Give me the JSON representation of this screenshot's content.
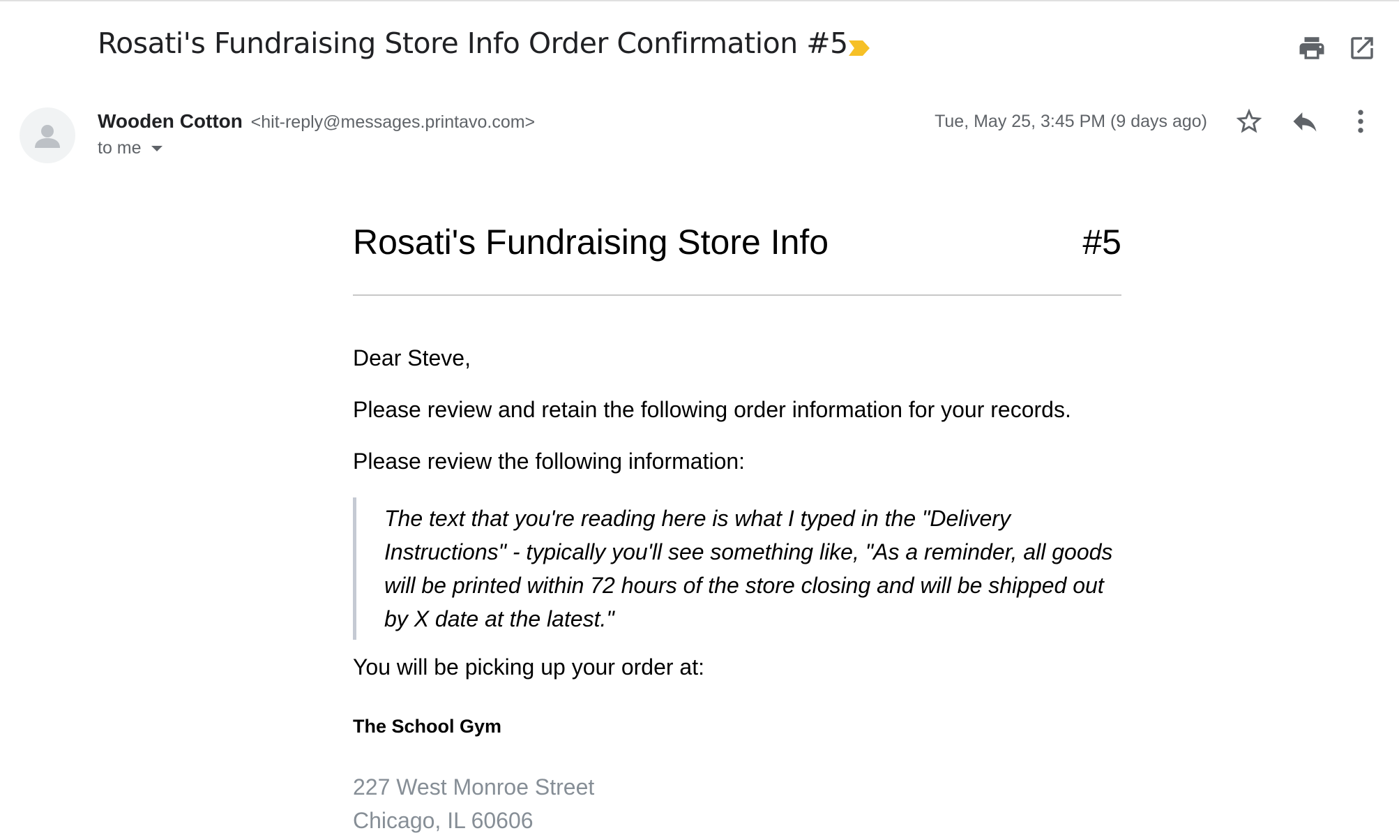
{
  "email": {
    "subject": "Rosati's Fundraising Store Info Order Confirmation #5",
    "label_color": "#f6c026",
    "sender": {
      "name": "Wooden Cotton",
      "address": "<hit-reply@messages.printavo.com>"
    },
    "recipient": "to me",
    "date": "Tue, May 25, 3:45 PM (9 days ago)",
    "icons": {
      "print": "print-icon",
      "open_new_window": "open-in-new-window-icon",
      "star": "star-icon",
      "reply": "reply-icon",
      "more": "more-vertical-icon",
      "avatar": "person-icon",
      "label": "important-label-icon"
    }
  },
  "body": {
    "store_title": "Rosati's Fundraising Store Info",
    "order_number": "#5",
    "greeting": "Dear Steve,",
    "intro": "Please review and retain the following order information for your records.",
    "review_prompt": "Please review the following information:",
    "delivery_instructions": "The text that you're reading here is what I typed in the \"Delivery Instructions\" - typically you'll see something like, \"As a reminder, all goods will be printed within 72 hours of the store closing and will be shipped out by X date at the latest.\"",
    "pickup_intro": "You will be picking up your order at:",
    "pickup_location": {
      "name": "The School Gym",
      "street": "227 West Monroe Street",
      "city_line": "Chicago, IL 60606"
    }
  }
}
